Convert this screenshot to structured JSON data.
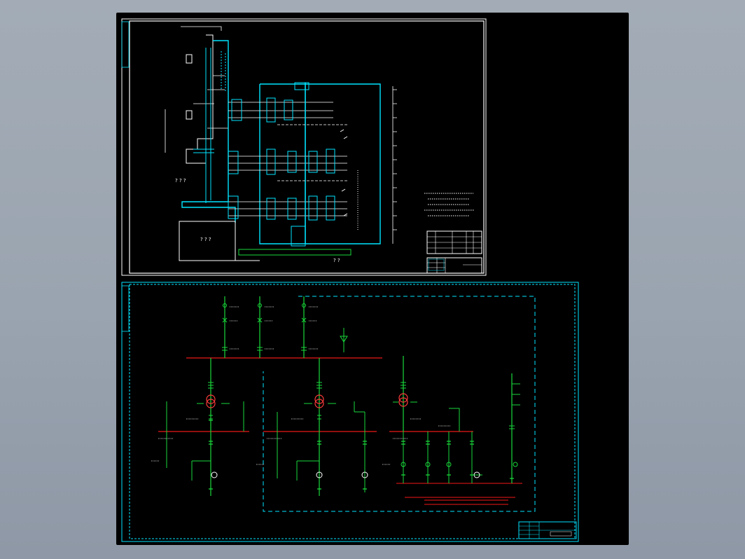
{
  "viewer": {
    "background_color": "#9ba5b1",
    "canvas_color": "#000000"
  },
  "sheets": [
    {
      "id": "layout-plan",
      "frame_color": "#ffffff",
      "primary_color": "#00e5ff",
      "accent_color": "#19d93b",
      "texts": {
        "room_label_left": "? ? ?",
        "room_label_bottom": "? ? ?",
        "floor_label": "? ?"
      }
    },
    {
      "id": "single-line-diagram",
      "frame_color": "#00e5ff",
      "equipment_color": "#19d93b",
      "busbar_color": "#c41414",
      "transformer_color": "#ff3b3b"
    }
  ]
}
